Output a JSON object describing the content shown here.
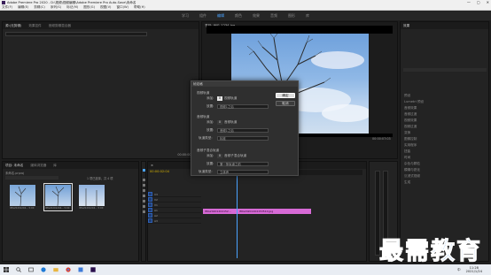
{
  "window": {
    "title": "Adobe Premiere Pro 2020 - D:\\视频\\视频编辑\\Adobe Premiere Pro Auto-Save\\未命名",
    "controls": [
      "—",
      "▢",
      "✕"
    ]
  },
  "menu": [
    "文件(F)",
    "编辑(E)",
    "剪辑(C)",
    "序列(S)",
    "标记(M)",
    "图形(G)",
    "视图(V)",
    "窗口(W)",
    "帮助(H)"
  ],
  "workspaces": [
    {
      "label": "学习",
      "active": false
    },
    {
      "label": "组件",
      "active": false
    },
    {
      "label": "编辑",
      "active": true
    },
    {
      "label": "颜色",
      "active": false
    },
    {
      "label": "效果",
      "active": false
    },
    {
      "label": "音频",
      "active": false
    },
    {
      "label": "图形",
      "active": false
    },
    {
      "label": "库",
      "active": false
    }
  ],
  "source_panel": {
    "tabs": [
      "源:(无剪辑)",
      "效果控件",
      "音频剪辑混合器"
    ],
    "timecode": "00:00:00:00"
  },
  "program_panel": {
    "tab": "节目: IMG_1234.jpg",
    "timecode_left": "00:00:02:04",
    "timecode_right": "00:00:07:03",
    "fit": "适合"
  },
  "right_panel": {
    "tab": "效果",
    "items": [
      "预设",
      "Lumetri 预设",
      "音频效果",
      "音频过渡",
      "视频效果",
      "视频过渡",
      "变换",
      "图像控制",
      "实用程序",
      "扭曲",
      "时间",
      "杂色与颗粒",
      "模糊与锐化",
      "沉浸式视频",
      "生成"
    ]
  },
  "project_panel": {
    "tabs": [
      "项目: 未命名",
      "媒体浏览器",
      "库"
    ],
    "project_file": "未命名.prproj",
    "selection_count": "1 项已选择，共 4 项",
    "clips": [
      {
        "name": "IMG20201204...",
        "duration": "5:00"
      },
      {
        "name": "IMG20201204...",
        "duration": "5:00"
      },
      {
        "name": "IMG20201204...",
        "duration": "5:00"
      }
    ]
  },
  "timeline": {
    "timecode": "00:00:02:04",
    "tracks": [
      "V3",
      "V2",
      "V1",
      "A1",
      "A2",
      "A3"
    ],
    "clips": [
      {
        "label": "IMG20201204152...",
        "color": "#d76ad6"
      },
      {
        "label": "IMG20201204153510.jpg",
        "color": "#d76ad6"
      }
    ]
  },
  "dialog": {
    "title": "帧定格",
    "sections": [
      {
        "header": "视频轨道",
        "rows": [
          {
            "label": "添加:",
            "value": "0",
            "suffix": "视频轨道"
          },
          {
            "label": "放置:",
            "value": "视频1之后"
          }
        ]
      },
      {
        "header": "音频轨道",
        "rows": [
          {
            "label": "添加:",
            "value": "0",
            "suffix": "音频轨道"
          },
          {
            "label": "放置:",
            "value": "音频1之后"
          },
          {
            "label": "轨道类型:",
            "value": "标准"
          }
        ]
      },
      {
        "header": "音频子混合轨道",
        "rows": [
          {
            "label": "添加:",
            "value": "0",
            "suffix": "音频子混合轨道"
          },
          {
            "label": "放置:",
            "value": "第一条轨道之前"
          },
          {
            "label": "轨道类型:",
            "value": "立体声"
          }
        ]
      }
    ],
    "ok_label": "确定",
    "cancel_label": "取消"
  },
  "taskbar": {
    "time": "11:28",
    "date": "2021/1/24",
    "lang": "中"
  },
  "watermark": "最需教育"
}
